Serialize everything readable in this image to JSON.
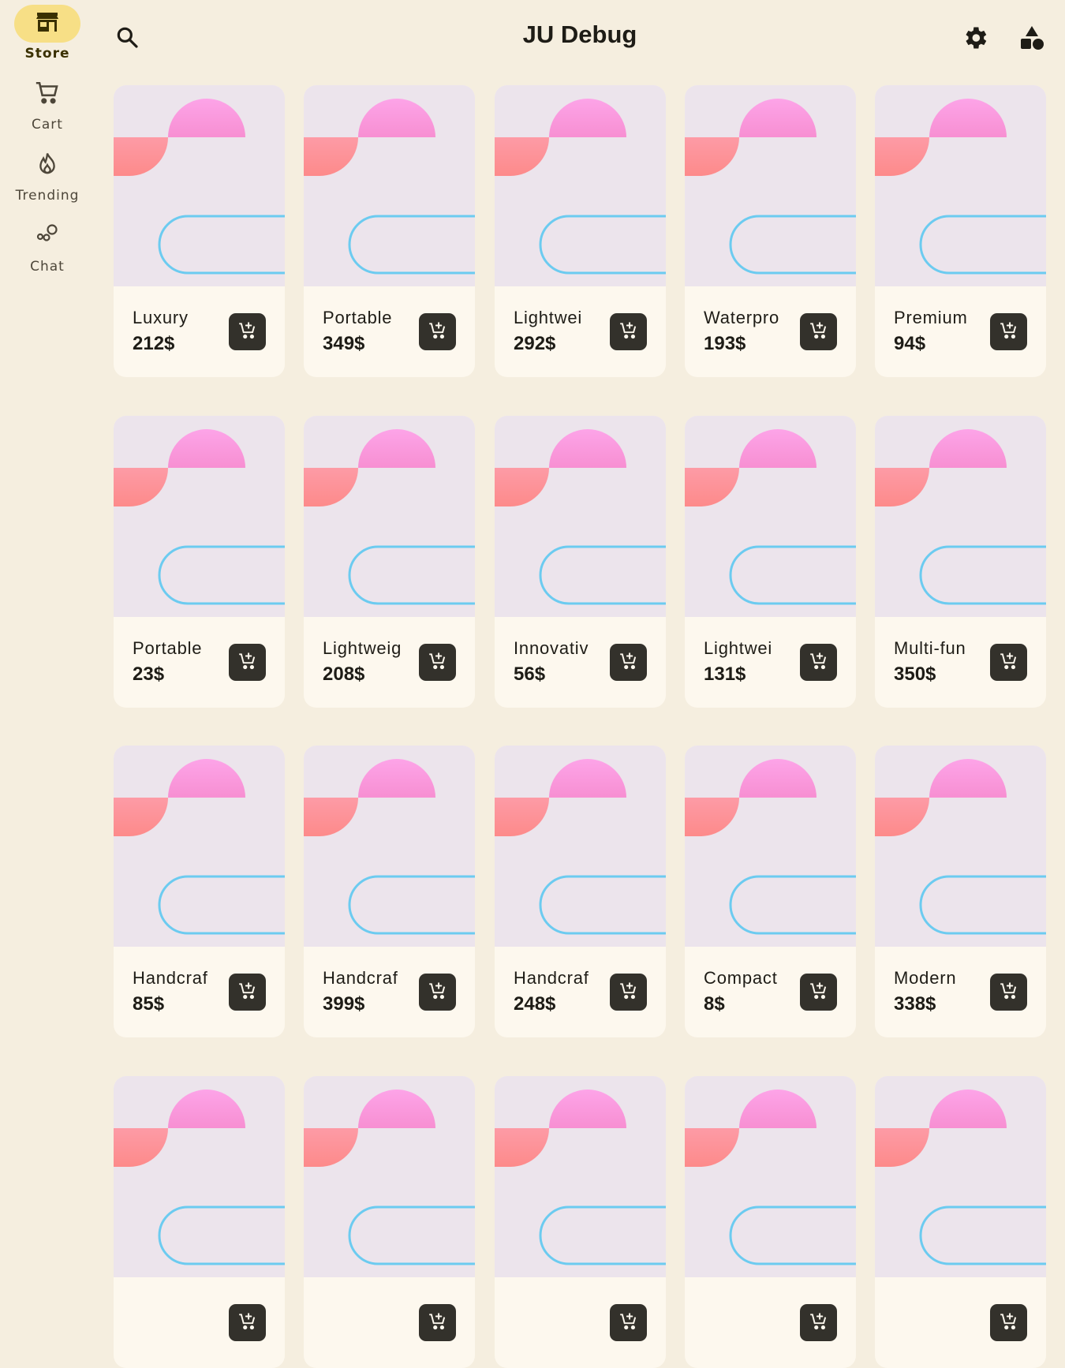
{
  "app": {
    "title": "JU Debug"
  },
  "nav": {
    "items": [
      {
        "label": "Store",
        "icon": "store-icon",
        "active": true
      },
      {
        "label": "Cart",
        "icon": "cart-icon"
      },
      {
        "label": "Trending",
        "icon": "trending-icon"
      },
      {
        "label": "Chat",
        "icon": "chat-icon"
      }
    ]
  },
  "toolbar": {
    "search_icon": "search-icon",
    "settings_icon": "gear-icon",
    "theme_icon": "shapes-icon"
  },
  "colors": {
    "background": "#f5eedf",
    "card": "#fdf8ee",
    "art_bg": "#ece4ec",
    "active_indicator": "#f7df86",
    "cart_button": "#33312b",
    "pink": "#fda4e8",
    "coral": "#fd8a8a",
    "outline_blue": "#6ccbf0"
  },
  "products": [
    {
      "name": "Luxury",
      "price": "212$"
    },
    {
      "name": "Portable",
      "price": "349$"
    },
    {
      "name": "Lightwei",
      "price": "292$"
    },
    {
      "name": "Waterpro",
      "price": "193$"
    },
    {
      "name": "Premium",
      "price": "94$"
    },
    {
      "name": "Portable",
      "price": "23$"
    },
    {
      "name": "Lightweig",
      "price": "208$"
    },
    {
      "name": "Innovativ",
      "price": "56$"
    },
    {
      "name": "Lightwei",
      "price": "131$"
    },
    {
      "name": "Multi-fun",
      "price": "350$"
    },
    {
      "name": "Handcraf",
      "price": "85$"
    },
    {
      "name": "Handcraf",
      "price": "399$"
    },
    {
      "name": "Handcraf",
      "price": "248$"
    },
    {
      "name": "Compact",
      "price": "8$"
    },
    {
      "name": "Modern",
      "price": "338$"
    },
    {
      "name": "",
      "price": ""
    },
    {
      "name": "",
      "price": ""
    },
    {
      "name": "",
      "price": ""
    },
    {
      "name": "",
      "price": ""
    },
    {
      "name": "",
      "price": ""
    }
  ]
}
